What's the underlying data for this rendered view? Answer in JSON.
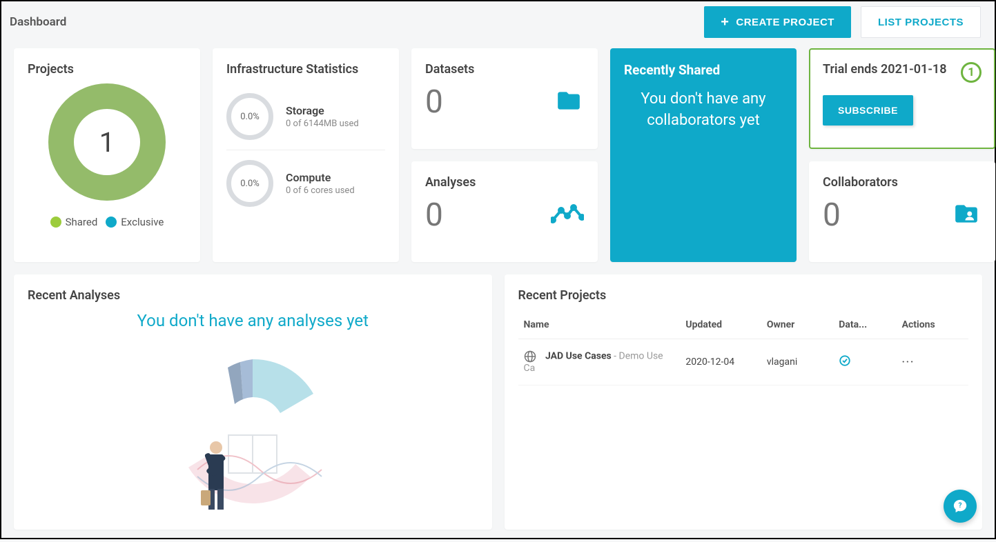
{
  "header": {
    "title": "Dashboard",
    "create_label": "CREATE PROJECT",
    "list_label": "LIST PROJECTS"
  },
  "projects": {
    "title": "Projects",
    "count": "1",
    "legend_shared": "Shared",
    "legend_exclusive": "Exclusive"
  },
  "infra": {
    "title": "Infrastructure Statistics",
    "storage_pct": "0.0%",
    "storage_label": "Storage",
    "storage_sub": "0 of 6144MB used",
    "compute_pct": "0.0%",
    "compute_label": "Compute",
    "compute_sub": "0 of 6 cores used"
  },
  "datasets": {
    "title": "Datasets",
    "count": "0"
  },
  "analyses": {
    "title": "Analyses",
    "count": "0"
  },
  "shared": {
    "title": "Recently Shared",
    "message": "You don't have any collaborators yet"
  },
  "trial": {
    "title": "Trial ends 2021-01-18",
    "badge": "1",
    "subscribe_label": "SUBSCRIBE"
  },
  "collaborators": {
    "title": "Collaborators",
    "count": "0"
  },
  "recent_analyses": {
    "title": "Recent Analyses",
    "empty": "You don't have any analyses yet"
  },
  "recent_projects": {
    "title": "Recent Projects",
    "columns": {
      "name": "Name",
      "updated": "Updated",
      "owner": "Owner",
      "data": "Data...",
      "actions": "Actions"
    },
    "rows": [
      {
        "name": "JAD Use Cases",
        "sub": " - Demo Use Ca",
        "updated": "2020-12-04",
        "owner": "vlagani",
        "actions": "···"
      }
    ]
  }
}
